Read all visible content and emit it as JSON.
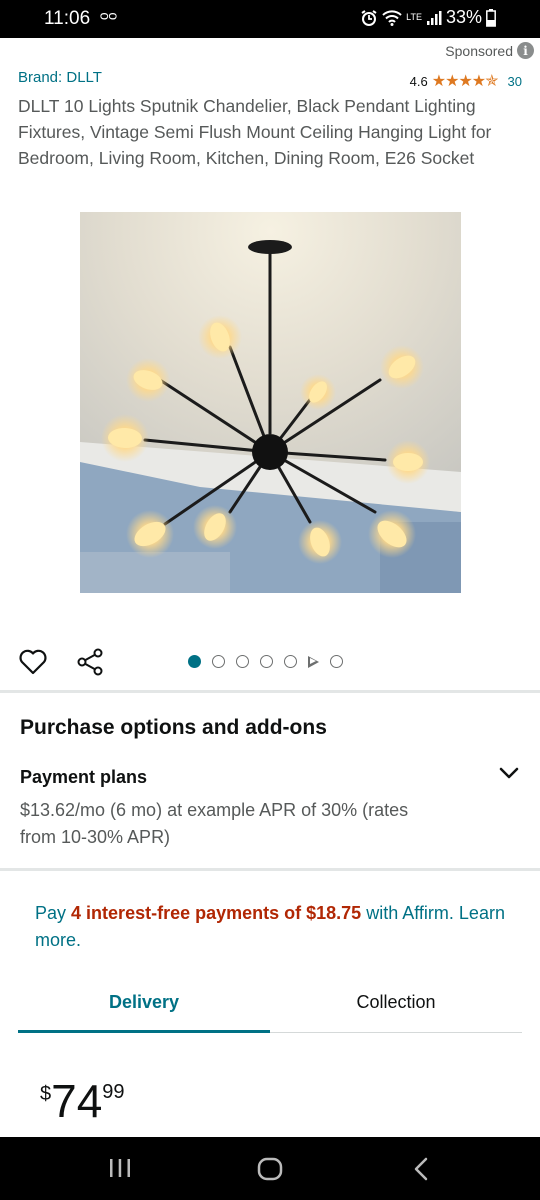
{
  "status": {
    "time": "11:06",
    "voicemail": "ᴑᴑ",
    "network": "LTE",
    "battery": "33%"
  },
  "sponsored": {
    "label": "Sponsored",
    "info_icon": "i"
  },
  "product": {
    "brand": "Brand: DLLT",
    "rating_value": "4.6",
    "stars": "★★★★✯",
    "rating_count": "30",
    "title": "DLLT 10 Lights Sputnik Chandelier, Black Pendant Lighting Fixtures, Vintage Semi Flush Mount Ceiling Hanging Light for Bedroom, Living Room, Kitchen, Dining Room, E26 Socket",
    "image_count": 7,
    "active_image": 1
  },
  "purchase": {
    "section_title": "Purchase options and add-ons",
    "payment_label": "Payment plans",
    "payment_text": "$13.62/mo (6 mo) at example APR of 30% (rates from 10-30% APR)"
  },
  "affirm": {
    "pay": "Pay",
    "highlight": "4 interest-free payments of $18.75",
    "rest": "with Affirm.",
    "learn_more": "Learn more."
  },
  "tabs": {
    "delivery": "Delivery",
    "collection": "Collection"
  },
  "price": {
    "symbol": "$",
    "whole": "74",
    "fraction": "99"
  },
  "colors": {
    "link": "#007185",
    "accent_red": "#b12704",
    "star": "#de7921"
  }
}
